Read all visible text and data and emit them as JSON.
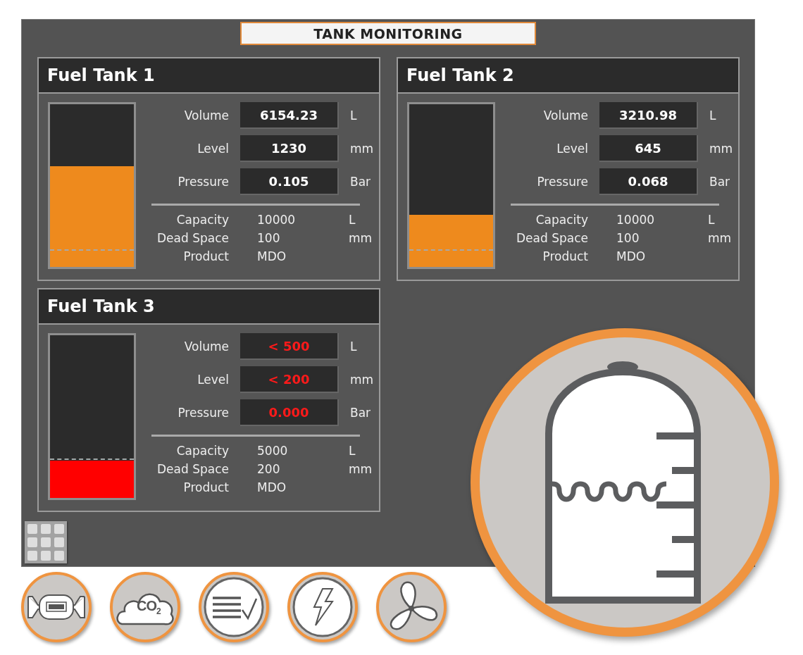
{
  "title": "TANK MONITORING",
  "tanks": [
    {
      "name": "Fuel Tank 1",
      "alarm": false,
      "fill": {
        "level": 0.62
      },
      "dead_space_mark": {
        "level": 0.1
      },
      "readings": [
        {
          "label": "Volume",
          "value": "6154.23",
          "unit": "L"
        },
        {
          "label": "Level",
          "value": "1230",
          "unit": "mm"
        },
        {
          "label": "Pressure",
          "value": "0.105",
          "unit": "Bar"
        }
      ],
      "specs": [
        {
          "label": "Capacity",
          "value": "10000",
          "unit": "L"
        },
        {
          "label": "Dead Space",
          "value": "100",
          "unit": "mm"
        },
        {
          "label": "Product",
          "value": "MDO"
        }
      ]
    },
    {
      "name": "Fuel Tank 2",
      "alarm": false,
      "fill": {
        "level": 0.32
      },
      "dead_space_mark": {
        "level": 0.1
      },
      "readings": [
        {
          "label": "Volume",
          "value": "3210.98",
          "unit": "L"
        },
        {
          "label": "Level",
          "value": "645",
          "unit": "mm"
        },
        {
          "label": "Pressure",
          "value": "0.068",
          "unit": "Bar"
        }
      ],
      "specs": [
        {
          "label": "Capacity",
          "value": "10000",
          "unit": "L"
        },
        {
          "label": "Dead Space",
          "value": "100",
          "unit": "mm"
        },
        {
          "label": "Product",
          "value": "MDO"
        }
      ]
    },
    {
      "name": "Fuel Tank 3",
      "alarm": true,
      "fill": {
        "level": 0.23
      },
      "dead_space_mark": {
        "level": 0.235
      },
      "readings": [
        {
          "label": "Volume",
          "value": "< 500",
          "unit": "L"
        },
        {
          "label": "Level",
          "value": "< 200",
          "unit": "mm"
        },
        {
          "label": "Pressure",
          "value": "0.000",
          "unit": "Bar"
        }
      ],
      "specs": [
        {
          "label": "Capacity",
          "value": "5000",
          "unit": "L"
        },
        {
          "label": "Dead Space",
          "value": "200",
          "unit": "mm"
        },
        {
          "label": "Product",
          "value": "MDO"
        }
      ]
    }
  ],
  "nav": [
    {
      "kind": "flowmeter"
    },
    {
      "kind": "emissions",
      "label": "CO$_{2}$"
    },
    {
      "kind": "checklist"
    },
    {
      "kind": "power"
    },
    {
      "kind": "propeller"
    }
  ],
  "featured": {
    "kind": "tank"
  }
}
